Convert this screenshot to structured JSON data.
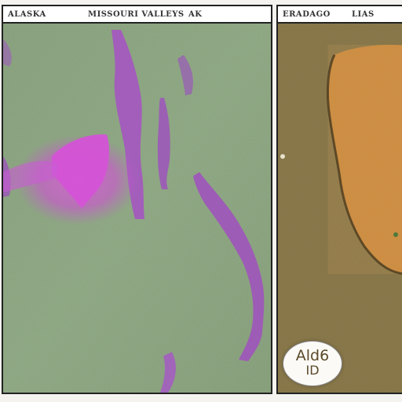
{
  "left_panel": {
    "header_left": "ALASKA",
    "header_center": "MISSOURI VALLEYS",
    "header_right": "AK"
  },
  "right_panel": {
    "header_left": "ERADAGO",
    "header_right": "LIAS",
    "badge_line1": "Ald6",
    "badge_line2": "ID"
  },
  "colors": {
    "left_ground": "#7e9b72",
    "left_ground_light": "#8fae80",
    "purple_vein": "#a653c4",
    "magenta_glow": "#e04bd8",
    "right_ground": "#7a6a3e",
    "right_orange": "#cf8a3c"
  }
}
